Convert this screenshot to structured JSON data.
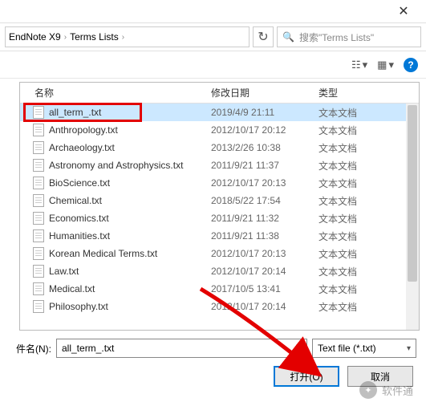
{
  "titlebar": {
    "close": "✕"
  },
  "breadcrumb": {
    "seg1": "EndNote X9",
    "seg2": "Terms Lists",
    "sep": "›"
  },
  "nav": {
    "refresh": "↻"
  },
  "search": {
    "icon": "🔍",
    "placeholder": "搜索\"Terms Lists\""
  },
  "toolbar": {
    "view_list": "☷",
    "view_tile": "▦",
    "drop": "▾",
    "help": "?"
  },
  "columns": {
    "name": "名称",
    "date": "修改日期",
    "type": "类型"
  },
  "files": [
    {
      "name": "all_term_.txt",
      "date": "2019/4/9 21:11",
      "type": "文本文档",
      "selected": true
    },
    {
      "name": "Anthropology.txt",
      "date": "2012/10/17 20:12",
      "type": "文本文档"
    },
    {
      "name": "Archaeology.txt",
      "date": "2013/2/26 10:38",
      "type": "文本文档"
    },
    {
      "name": "Astronomy and Astrophysics.txt",
      "date": "2011/9/21 11:37",
      "type": "文本文档"
    },
    {
      "name": "BioScience.txt",
      "date": "2012/10/17 20:13",
      "type": "文本文档"
    },
    {
      "name": "Chemical.txt",
      "date": "2018/5/22 17:54",
      "type": "文本文档"
    },
    {
      "name": "Economics.txt",
      "date": "2011/9/21 11:32",
      "type": "文本文档"
    },
    {
      "name": "Humanities.txt",
      "date": "2011/9/21 11:38",
      "type": "文本文档"
    },
    {
      "name": "Korean Medical Terms.txt",
      "date": "2012/10/17 20:13",
      "type": "文本文档"
    },
    {
      "name": "Law.txt",
      "date": "2012/10/17 20:14",
      "type": "文本文档"
    },
    {
      "name": "Medical.txt",
      "date": "2017/10/5 13:41",
      "type": "文本文档"
    },
    {
      "name": "Philosophy.txt",
      "date": "2012/10/17 20:14",
      "type": "文本文档"
    }
  ],
  "filename": {
    "label": "件名(N):",
    "value": "all_term_.txt"
  },
  "filter": {
    "value": "Text file  (*.txt)"
  },
  "buttons": {
    "open": "打开(O)",
    "cancel": "取消"
  },
  "watermark": {
    "text": "软件通"
  }
}
